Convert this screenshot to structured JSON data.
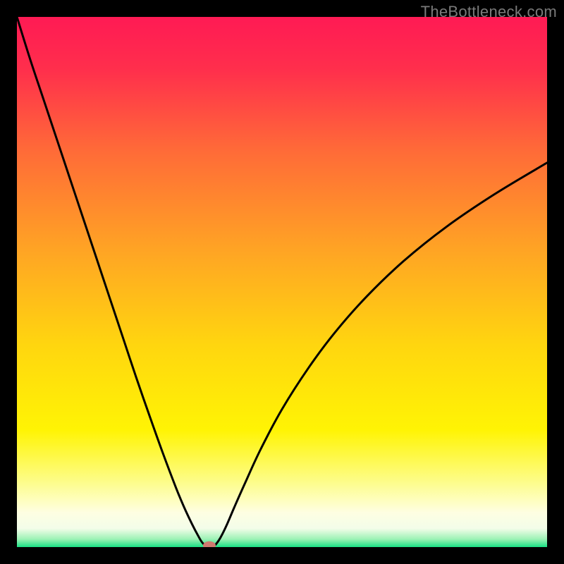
{
  "watermark": "TheBottleneck.com",
  "chart_data": {
    "type": "line",
    "title": "",
    "xlabel": "",
    "ylabel": "",
    "xlim": [
      0,
      100
    ],
    "ylim": [
      0,
      100
    ],
    "background_gradient_stops": [
      {
        "offset": 0.0,
        "color": "#ff1a54"
      },
      {
        "offset": 0.1,
        "color": "#ff2f4c"
      },
      {
        "offset": 0.25,
        "color": "#ff6a38"
      },
      {
        "offset": 0.45,
        "color": "#ffa723"
      },
      {
        "offset": 0.62,
        "color": "#ffd60f"
      },
      {
        "offset": 0.78,
        "color": "#fff404"
      },
      {
        "offset": 0.88,
        "color": "#fdfd8e"
      },
      {
        "offset": 0.935,
        "color": "#fefee2"
      },
      {
        "offset": 0.965,
        "color": "#f3fde9"
      },
      {
        "offset": 0.985,
        "color": "#9cf2b5"
      },
      {
        "offset": 1.0,
        "color": "#18e084"
      }
    ],
    "series": [
      {
        "name": "bottleneck-curve",
        "x": [
          0.0,
          2.5,
          5.0,
          7.5,
          10.0,
          12.5,
          15.0,
          17.5,
          20.0,
          22.5,
          25.0,
          27.5,
          30.0,
          31.5,
          33.0,
          34.2,
          35.0,
          36.0,
          36.8,
          37.5,
          38.4,
          39.5,
          41.0,
          43.0,
          46.0,
          50.0,
          55.0,
          60.0,
          66.0,
          73.0,
          81.0,
          90.0,
          100.0
        ],
        "y": [
          100.0,
          92.0,
          84.5,
          77.0,
          69.5,
          62.0,
          54.5,
          47.0,
          39.5,
          32.0,
          24.8,
          17.8,
          11.2,
          7.6,
          4.4,
          2.1,
          0.8,
          0.0,
          0.0,
          0.5,
          1.8,
          4.0,
          7.5,
          12.0,
          18.5,
          26.0,
          33.8,
          40.5,
          47.3,
          54.0,
          60.4,
          66.5,
          72.5
        ]
      }
    ],
    "marker": {
      "x": 36.3,
      "y": 0.3,
      "color": "#cf7b70",
      "rx": 9,
      "ry": 6
    }
  }
}
